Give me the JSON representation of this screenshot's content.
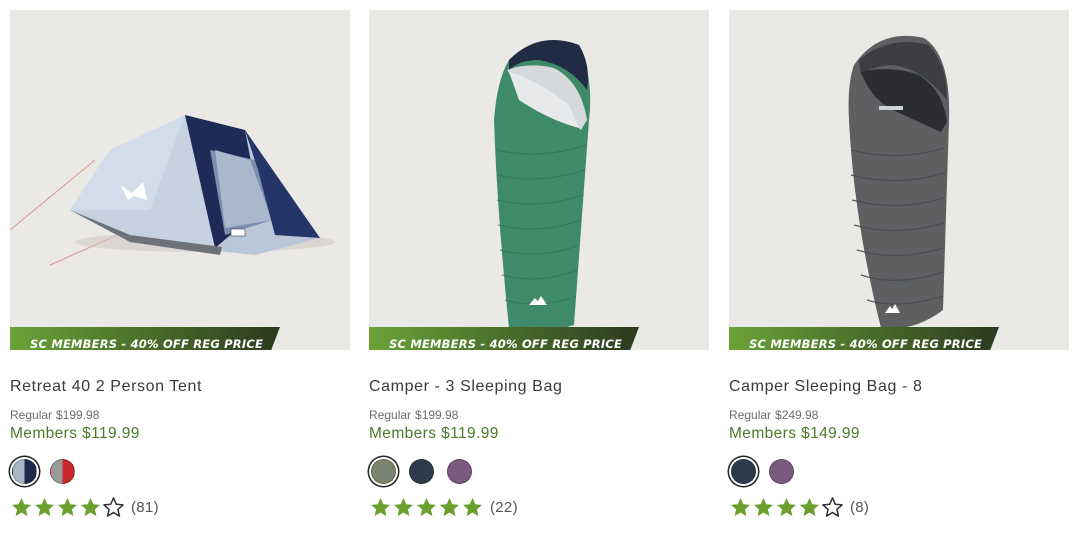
{
  "colors": {
    "promo_start": "#6aa336",
    "promo_end": "#2b3a20",
    "members_price": "#4a7a2a",
    "star_filled": "#6a9e2d",
    "star_empty": "#333333"
  },
  "products": [
    {
      "image": "tent-icon",
      "promo": "SC MEMBERS - 40% OFF REG PRICE",
      "title": "Retreat 40 2 Person Tent",
      "regular_label": "Regular",
      "regular_price": "$199.98",
      "members_price": "Members $119.99",
      "swatches": [
        {
          "name": "light-blue-navy",
          "colors": [
            "#a9b6c7",
            "#1d2a4d"
          ],
          "selected": true
        },
        {
          "name": "grey-red",
          "colors": [
            "#9a9a9a",
            "#c8272b"
          ],
          "selected": false
        }
      ],
      "rating": 4,
      "rating_max": 5,
      "review_count": "(81)"
    },
    {
      "image": "sleeping-bag-green-icon",
      "promo": "SC MEMBERS - 40% OFF REG PRICE",
      "title": "Camper - 3 Sleeping Bag",
      "regular_label": "Regular",
      "regular_price": "$199.98",
      "members_price": "Members $119.99",
      "swatches": [
        {
          "name": "green",
          "colors": [
            "#7b8471"
          ],
          "selected": true
        },
        {
          "name": "navy",
          "colors": [
            "#2e3b4a"
          ],
          "selected": false
        },
        {
          "name": "purple",
          "colors": [
            "#7b5a80"
          ],
          "selected": false
        }
      ],
      "rating": 5,
      "rating_max": 5,
      "review_count": "(22)"
    },
    {
      "image": "sleeping-bag-grey-icon",
      "promo": "SC MEMBERS - 40% OFF REG PRICE",
      "title": "Camper Sleeping Bag - 8",
      "regular_label": "Regular",
      "regular_price": "$249.98",
      "members_price": "Members $149.99",
      "swatches": [
        {
          "name": "navy",
          "colors": [
            "#2e3b4a"
          ],
          "selected": true
        },
        {
          "name": "purple",
          "colors": [
            "#7b5a80"
          ],
          "selected": false
        }
      ],
      "rating": 4,
      "rating_max": 5,
      "review_count": "(8)"
    }
  ]
}
